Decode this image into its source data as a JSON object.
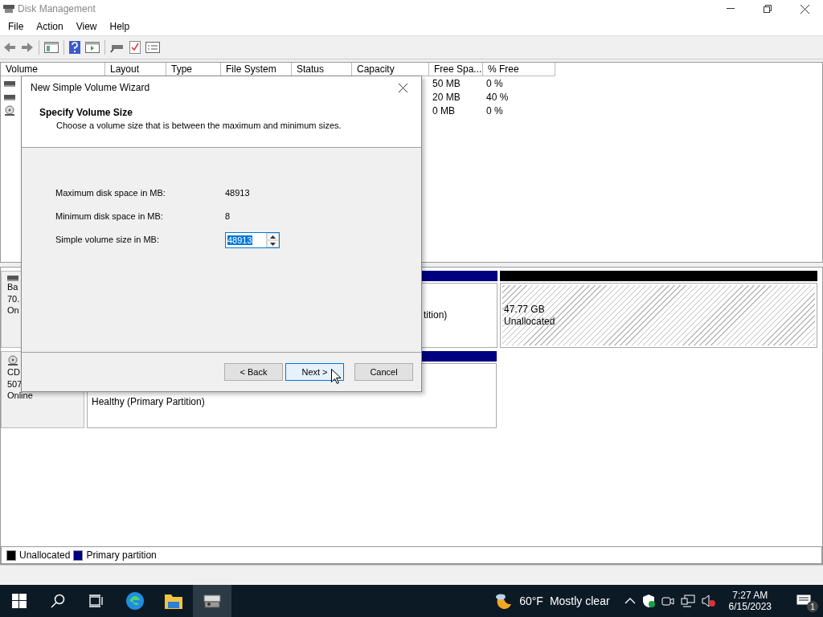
{
  "window": {
    "title": "Disk Management"
  },
  "menu": [
    "File",
    "Action",
    "View",
    "Help"
  ],
  "volume_list": {
    "columns": [
      "Volume",
      "Layout",
      "Type",
      "File System",
      "Status",
      "Capacity",
      "Free Spa...",
      "% Free"
    ],
    "rows": [
      {
        "kind": "disk",
        "volume": "",
        "free_space": "50 MB",
        "percent_free": "0 %"
      },
      {
        "kind": "disk",
        "volume": "",
        "free_space": "20 MB",
        "percent_free": "40 %"
      },
      {
        "kind": "cdrom",
        "volume": "",
        "free_space": "0 MB",
        "percent_free": "0 %"
      }
    ]
  },
  "disks": [
    {
      "kind": "disk",
      "label_lines": [
        "Ba",
        "70.",
        "On"
      ],
      "partitions": [
        {
          "kind": "primary",
          "lines": [
            "tition)"
          ]
        },
        {
          "kind": "unallocated",
          "lines": [
            "47.77 GB",
            "Unallocated"
          ]
        }
      ]
    },
    {
      "kind": "cdrom",
      "label_lines": [
        "CD",
        "507",
        "Online"
      ],
      "partitions": [
        {
          "kind": "primary",
          "lines": [
            "Healthy (Primary Partition)"
          ]
        }
      ]
    }
  ],
  "legend": [
    {
      "label": "Unallocated",
      "color": "#000000"
    },
    {
      "label": "Primary partition",
      "color": "#000080"
    }
  ],
  "dialog": {
    "title": "New Simple Volume Wizard",
    "heading": "Specify Volume Size",
    "subtitle": "Choose a volume size that is between the maximum and minimum sizes.",
    "fields": [
      {
        "kind": "readout",
        "label": "Maximum disk space in MB:",
        "value": "48913"
      },
      {
        "kind": "readout",
        "label": "Minimum disk space in MB:",
        "value": "8"
      },
      {
        "kind": "spin",
        "label": "Simple volume size in MB:",
        "value": "48913",
        "text_selected": true
      }
    ],
    "buttons": [
      {
        "label": "< Back",
        "focused": false
      },
      {
        "label": "Next >",
        "focused": true
      },
      {
        "label": "Cancel",
        "focused": false
      }
    ]
  },
  "taskbar": {
    "apps": [
      {
        "kind": "edge",
        "active": false
      },
      {
        "kind": "explorer",
        "active": false
      },
      {
        "kind": "diskmgmt",
        "active": true
      }
    ],
    "weather": {
      "temperature": "60°F",
      "condition": "Mostly clear"
    },
    "time": "7:27 AM",
    "date": "6/15/2023",
    "notification_count": "1"
  }
}
